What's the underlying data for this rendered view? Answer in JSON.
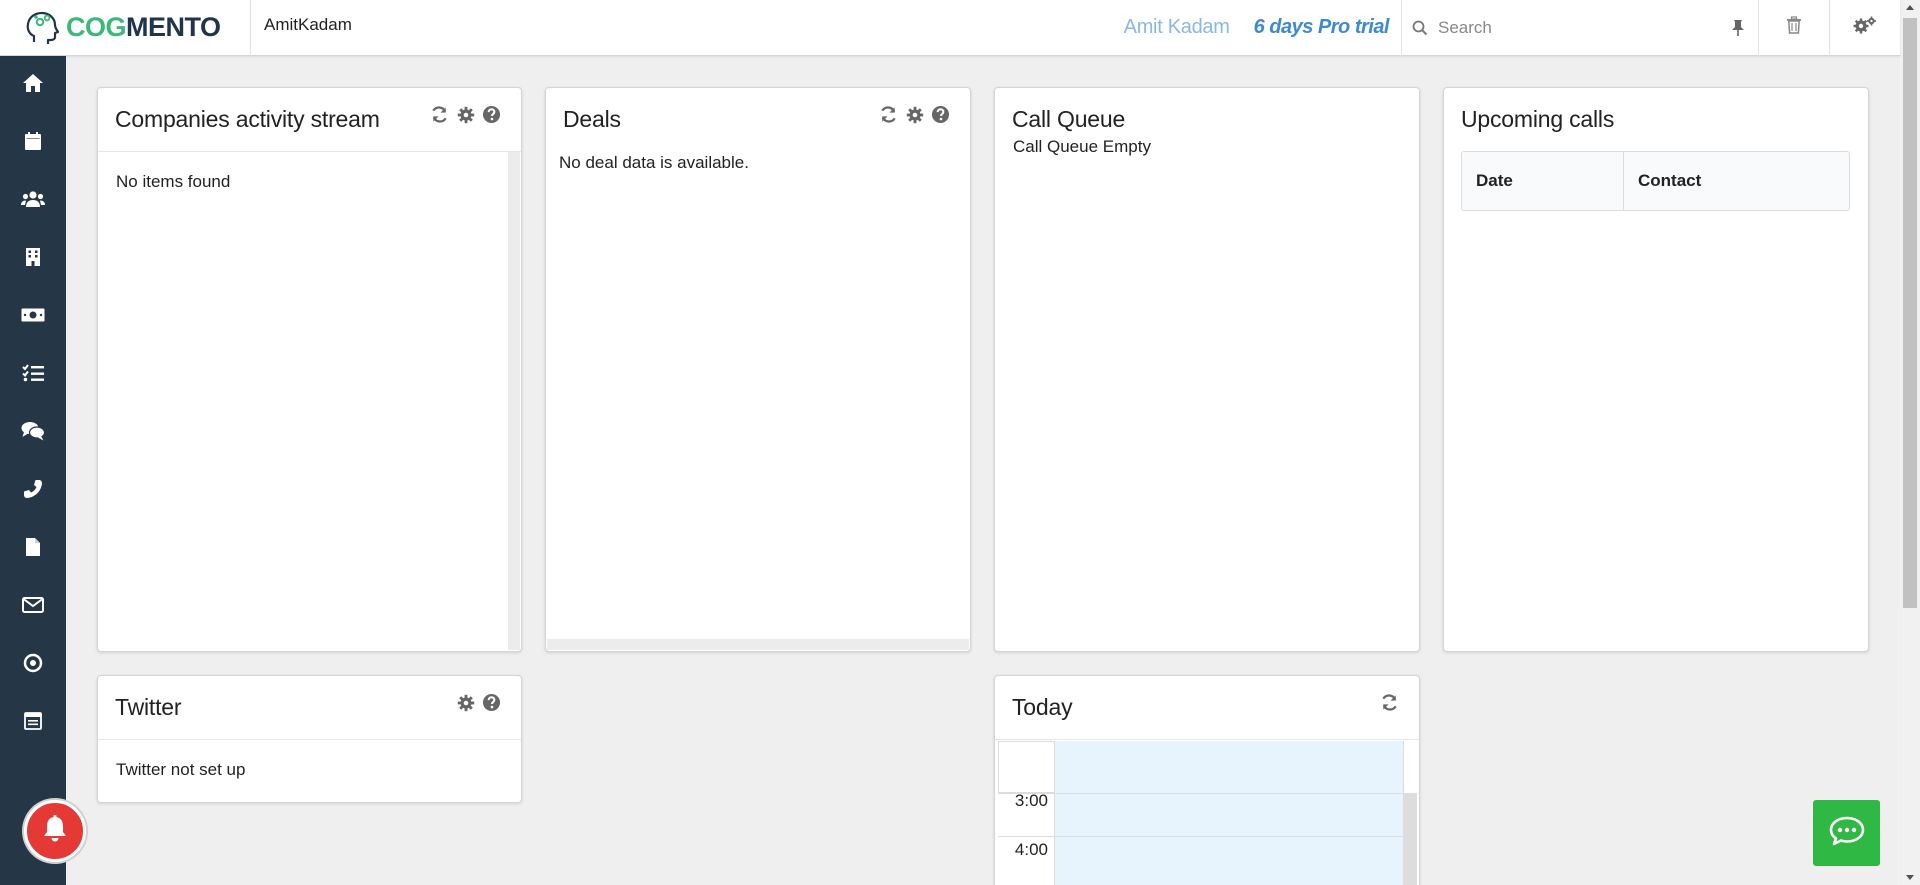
{
  "brand": {
    "logo_part1": "COG",
    "logo_part2": "MENTO",
    "accent_green": "#3cb878",
    "navy": "#20354d"
  },
  "header": {
    "account_name": "AmitKadam",
    "user_name": "Amit Kadam",
    "trial_text": "6 days Pro trial",
    "search_placeholder": "Search",
    "icons": [
      "search-icon",
      "pin-icon",
      "trash-icon",
      "settings-icon"
    ]
  },
  "sidebar": {
    "background": "#253746",
    "items": [
      {
        "icon": "home-icon",
        "label": "Home"
      },
      {
        "icon": "calendar-icon",
        "label": "Calendar"
      },
      {
        "icon": "contacts-icon",
        "label": "Contacts"
      },
      {
        "icon": "companies-icon",
        "label": "Companies"
      },
      {
        "icon": "deals-icon",
        "label": "Deals"
      },
      {
        "icon": "tasks-icon",
        "label": "Tasks"
      },
      {
        "icon": "cases-icon",
        "label": "Cases"
      },
      {
        "icon": "calls-icon",
        "label": "Calls"
      },
      {
        "icon": "documents-icon",
        "label": "Documents"
      },
      {
        "icon": "email-icon",
        "label": "Email"
      },
      {
        "icon": "campaigns-icon",
        "label": "Campaigns"
      },
      {
        "icon": "forms-icon",
        "label": "Forms"
      }
    ]
  },
  "cards": {
    "companies_activity": {
      "title": "Companies activity stream",
      "empty_text": "No items found"
    },
    "deals": {
      "title": "Deals",
      "empty_text": "No deal data is available."
    },
    "call_queue": {
      "title": "Call Queue",
      "empty_text": "Call Queue Empty"
    },
    "upcoming_calls": {
      "title": "Upcoming calls",
      "columns": [
        "Date",
        "Contact"
      ]
    },
    "twitter": {
      "title": "Twitter",
      "empty_text": "Twitter not set up"
    },
    "today": {
      "title": "Today",
      "times": [
        "3:00",
        "4:00"
      ]
    }
  },
  "floating": {
    "bell_color": "#e53935",
    "chat_color": "#2fb944"
  }
}
